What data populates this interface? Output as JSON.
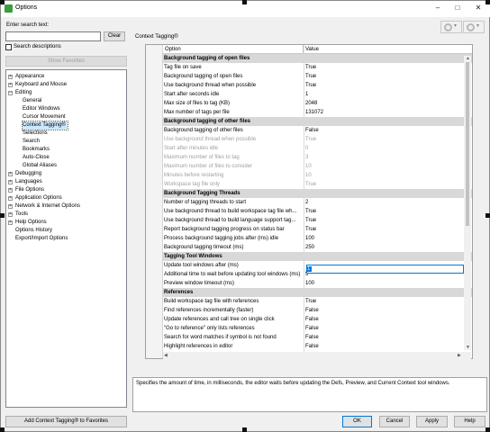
{
  "window": {
    "title": "Options",
    "minimize": "–",
    "maximize": "□",
    "close": "✕"
  },
  "search": {
    "label": "Enter search text:",
    "value": "",
    "clear": "Clear",
    "descriptions": "Search descriptions",
    "show_favorites": "Show Favorites"
  },
  "tree": [
    {
      "label": "Appearance",
      "level": 0,
      "expander": "+"
    },
    {
      "label": "Keyboard and Mouse",
      "level": 0,
      "expander": "+"
    },
    {
      "label": "Editing",
      "level": 0,
      "expander": "–"
    },
    {
      "label": "General",
      "level": 1,
      "expander": ""
    },
    {
      "label": "Editor Windows",
      "level": 1,
      "expander": ""
    },
    {
      "label": "Cursor Movement",
      "level": 1,
      "expander": ""
    },
    {
      "label": "Context Tagging®",
      "level": 1,
      "expander": "",
      "selected": true
    },
    {
      "label": "Selections",
      "level": 1,
      "expander": ""
    },
    {
      "label": "Search",
      "level": 1,
      "expander": ""
    },
    {
      "label": "Bookmarks",
      "level": 1,
      "expander": ""
    },
    {
      "label": "Auto-Close",
      "level": 1,
      "expander": ""
    },
    {
      "label": "Global Aliases",
      "level": 1,
      "expander": ""
    },
    {
      "label": "Debugging",
      "level": 0,
      "expander": "+"
    },
    {
      "label": "Languages",
      "level": 0,
      "expander": "+"
    },
    {
      "label": "File Options",
      "level": 0,
      "expander": "+"
    },
    {
      "label": "Application Options",
      "level": 0,
      "expander": "+"
    },
    {
      "label": "Network & Internet Options",
      "level": 0,
      "expander": "+"
    },
    {
      "label": "Tools",
      "level": 0,
      "expander": "+"
    },
    {
      "label": "Help Options",
      "level": 0,
      "expander": "+"
    },
    {
      "label": "Options History",
      "level": 0,
      "expander": ""
    },
    {
      "label": "Export/Import Options",
      "level": 0,
      "expander": ""
    }
  ],
  "panel_title": "Context Tagging®",
  "grid": {
    "header": {
      "option": "Option",
      "value": "Value"
    },
    "rows": [
      {
        "type": "section",
        "option": "Background tagging of open files",
        "value": ""
      },
      {
        "type": "item",
        "option": "Tag file on save",
        "value": "True"
      },
      {
        "type": "item",
        "option": "Background tagging of open files",
        "value": "True"
      },
      {
        "type": "item",
        "option": "Use background thread when possible",
        "value": "True"
      },
      {
        "type": "item",
        "option": "Start after seconds idle",
        "value": "1"
      },
      {
        "type": "item",
        "option": "Max size of files to tag (KB)",
        "value": "2048"
      },
      {
        "type": "item",
        "option": "Max number of tags per file",
        "value": "131072"
      },
      {
        "type": "section",
        "option": "Background tagging of other files",
        "value": ""
      },
      {
        "type": "item",
        "option": "Background tagging of other files",
        "value": "False"
      },
      {
        "type": "disabled",
        "option": "Use background thread when possible",
        "value": "True"
      },
      {
        "type": "disabled",
        "option": "Start after minutes idle",
        "value": "0"
      },
      {
        "type": "disabled",
        "option": "Maximum number of files to tag",
        "value": "3"
      },
      {
        "type": "disabled",
        "option": "Maximum number of files to consider",
        "value": "10"
      },
      {
        "type": "disabled",
        "option": "Minutes before restarting",
        "value": "10"
      },
      {
        "type": "disabled",
        "option": "Workspace tag file only",
        "value": "True"
      },
      {
        "type": "section",
        "option": "Background Tagging Threads",
        "value": ""
      },
      {
        "type": "item",
        "option": "Number of tagging threads to start",
        "value": "2"
      },
      {
        "type": "item",
        "option": "Use background thread to build workspace tag file wh...",
        "value": "True"
      },
      {
        "type": "item",
        "option": "Use background thread to build language support tag...",
        "value": "True"
      },
      {
        "type": "item",
        "option": "Report background tagging progress on status bar",
        "value": "True"
      },
      {
        "type": "item",
        "option": "Process background tagging jobs after (ms) idle",
        "value": "100"
      },
      {
        "type": "item",
        "option": "Background tagging timeout (ms)",
        "value": "250"
      },
      {
        "type": "section",
        "option": "Tagging Tool Windows",
        "value": ""
      },
      {
        "type": "item",
        "option": "Update tool windows after (ms)",
        "value": ""
      },
      {
        "type": "item",
        "option": "Additional time to wait before updating tool windows (ms)",
        "value": "5"
      },
      {
        "type": "item",
        "option": "Preview window timeout (ms)",
        "value": "100"
      },
      {
        "type": "section",
        "option": "References",
        "value": ""
      },
      {
        "type": "item",
        "option": "Build workspace tag file with references",
        "value": "True"
      },
      {
        "type": "item",
        "option": "Find references incrementally (faster)",
        "value": "False"
      },
      {
        "type": "item",
        "option": "Update references and call tree on single click",
        "value": "False"
      },
      {
        "type": "item",
        "option": "\"Go to reference\" only lists references",
        "value": "False"
      },
      {
        "type": "item",
        "option": "Search for word matches if symbol is not found",
        "value": "False"
      },
      {
        "type": "item",
        "option": "Highlight references in editor",
        "value": "False"
      }
    ],
    "edit_value": "1"
  },
  "description": "Specifies the amount of time, in milliseconds, the editor waits before updating the Defs, Preview, and Current Context tool windows.",
  "buttons": {
    "add_favorite": "Add Context Tagging® to Favorites",
    "ok": "OK",
    "cancel": "Cancel",
    "apply": "Apply",
    "help": "Help"
  },
  "icons": {
    "app": "app-icon",
    "settings": "gear-icon",
    "dropdown": "chevron-down-icon"
  },
  "colors": {
    "selection": "#cce8ff",
    "focus": "#0078d7",
    "section": "#d8d8d8"
  }
}
